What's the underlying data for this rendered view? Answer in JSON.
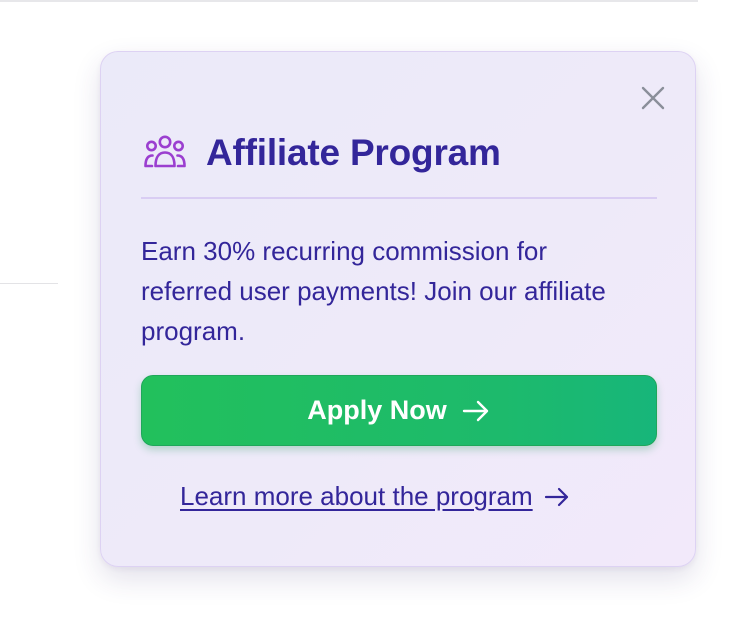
{
  "card": {
    "title": "Affiliate Program",
    "header_icon": "users-group-icon",
    "close_icon": "close-icon",
    "description": "Earn 30% recurring commission for referred user payments! Join our affiliate program.",
    "apply_label": "Apply Now",
    "apply_icon": "arrow-right-icon",
    "learn_more_label": "Learn more about the program",
    "learn_more_icon": "arrow-right-icon"
  },
  "colors": {
    "title_text": "#33269a",
    "icon_purple": "#9b3fd0",
    "button_green": "#22c05c",
    "close_gray": "#8a8f9a"
  }
}
